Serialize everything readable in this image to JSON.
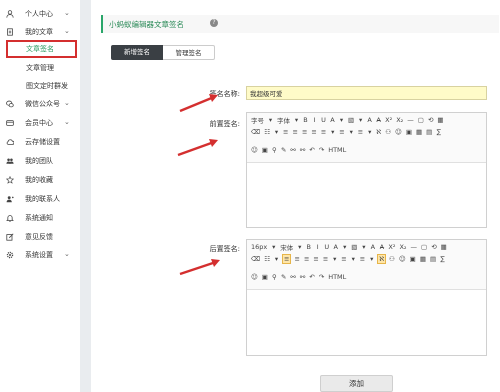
{
  "sidebar": {
    "items": [
      {
        "label": "个人中心",
        "icon": "user-icon",
        "chevron": true
      },
      {
        "label": "我的文章",
        "icon": "document-icon",
        "chevron": true
      },
      {
        "label": "文章签名",
        "sub": true,
        "selected": true
      },
      {
        "label": "文章管理",
        "sub": true
      },
      {
        "label": "图文定时群发",
        "sub": true
      },
      {
        "label": "微信公众号",
        "icon": "wechat-icon",
        "chevron": true
      },
      {
        "label": "会员中心",
        "icon": "card-icon",
        "chevron": true
      },
      {
        "label": "云存储设置",
        "icon": "cloud-icon"
      },
      {
        "label": "我的团队",
        "icon": "team-icon"
      },
      {
        "label": "我的收藏",
        "icon": "star-icon"
      },
      {
        "label": "我的联系人",
        "icon": "contacts-icon"
      },
      {
        "label": "系统通知",
        "icon": "bell-icon"
      },
      {
        "label": "意见反馈",
        "icon": "edit-icon"
      },
      {
        "label": "系统设置",
        "icon": "gear-icon",
        "chevron": true
      }
    ],
    "chevron_glyph": "⌄"
  },
  "header": {
    "title": "小蚂蚁编辑器文章签名",
    "help_glyph": "?"
  },
  "tabs": {
    "add": "新增签名",
    "manage": "管理签名"
  },
  "form": {
    "name_label": "签名名称:",
    "name_value": "我超级可爱",
    "pre_label": "前置签名:",
    "post_label": "后置签名:"
  },
  "editor_pre": {
    "row1": [
      "字号",
      "▾",
      "字体",
      "▾",
      "B",
      "I",
      "U",
      "A",
      "▾",
      "▧",
      "▾",
      "A",
      "A̶",
      "X²",
      "X₂",
      "—",
      "▢",
      "⟲",
      "▦"
    ],
    "row2": [
      "⌫",
      "☷",
      "▾",
      "≡",
      "≡",
      "≡",
      "≡",
      "≡",
      "▾",
      "≡",
      "▾",
      "≡",
      "▾",
      "ℵ",
      "⚇",
      "☺",
      "▣",
      "▦",
      "▤",
      "∑"
    ],
    "row3": [
      "☺",
      "▣",
      "⚲",
      "✎",
      "⚯",
      "⚯",
      "↶",
      "↷",
      "HTML"
    ]
  },
  "editor_post": {
    "row1": [
      "16px",
      "▾",
      "宋体",
      "▾",
      "B",
      "I",
      "U",
      "A",
      "▾",
      "▧",
      "▾",
      "A",
      "A̶",
      "X²",
      "X₂",
      "—",
      "▢",
      "⟲",
      "▦"
    ],
    "row2": [
      "⌫",
      "☷",
      "▾",
      "≡",
      "≡",
      "≡",
      "≡",
      "≡",
      "▾",
      "≡",
      "▾",
      "≡",
      "▾",
      "ℵ",
      "⚇",
      "☺",
      "▣",
      "▦",
      "▤",
      "∑"
    ],
    "row3": [
      "☺",
      "▣",
      "⚲",
      "✎",
      "⚯",
      "⚯",
      "↶",
      "↷",
      "HTML"
    ]
  },
  "submit_label": "添加",
  "colors": {
    "accent_green": "#2aa66a",
    "highlight_red": "#d42f2f",
    "input_yellow": "#fffbc8",
    "tab_dark": "#3a3f44"
  }
}
